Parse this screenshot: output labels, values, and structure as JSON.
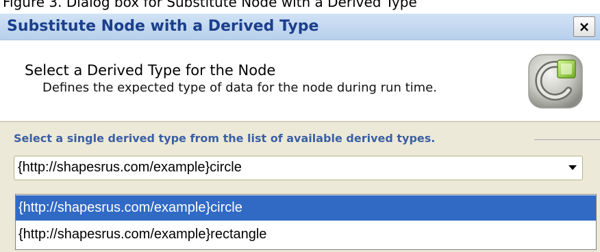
{
  "caption": {
    "text": "Figure 3. Dialog box for Substitute Node with a Derived Type"
  },
  "dialog": {
    "title": "Substitute Node with a Derived Type",
    "close_label": "×"
  },
  "header": {
    "heading": "Select a Derived Type for the Node",
    "subheading": "Defines the expected type of data for the node during run time.",
    "logo_icon": "wizard-logo-icon"
  },
  "content": {
    "instruction": "Select a single derived type from the list of available derived types.",
    "combo": {
      "value": "{http://shapesrus.com/example}circle",
      "arrow_icon": "chevron-down-icon"
    },
    "options": [
      {
        "label": "{http://shapesrus.com/example}circle",
        "selected": true
      },
      {
        "label": "{http://shapesrus.com/example}rectangle",
        "selected": false
      }
    ]
  },
  "colors": {
    "title_text": "#1b3f8c",
    "title_bar": "#c4d9f1",
    "instruction_text": "#3a5fa5",
    "panel_background": "#ece9d8",
    "selection_highlight": "#316ac5"
  }
}
